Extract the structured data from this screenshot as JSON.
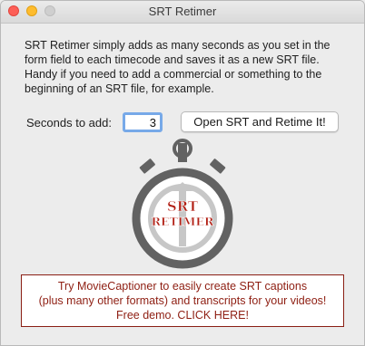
{
  "window": {
    "title": "SRT Retimer"
  },
  "description": "SRT Retimer simply adds as many seconds as you set in the form field to each timecode and saves it as a new SRT file. Handy if you need to add a commercial or something to the beginning of an SRT file, for example.",
  "form": {
    "seconds_label": "Seconds to add:",
    "seconds_value": "3",
    "open_button_label": "Open SRT and Retime It!"
  },
  "logo": {
    "line1": "SRT",
    "line2": "RETIMER"
  },
  "promo": {
    "line1": "Try MovieCaptioner to easily create SRT captions",
    "line2": "(plus many other formats) and transcripts for your videos!",
    "line3": "Free demo. CLICK HERE!"
  },
  "colors": {
    "promo_text": "#8e1e12",
    "logo_gray": "#626262",
    "logo_red": "#b11d12",
    "focus_ring": "#77a9e8"
  }
}
